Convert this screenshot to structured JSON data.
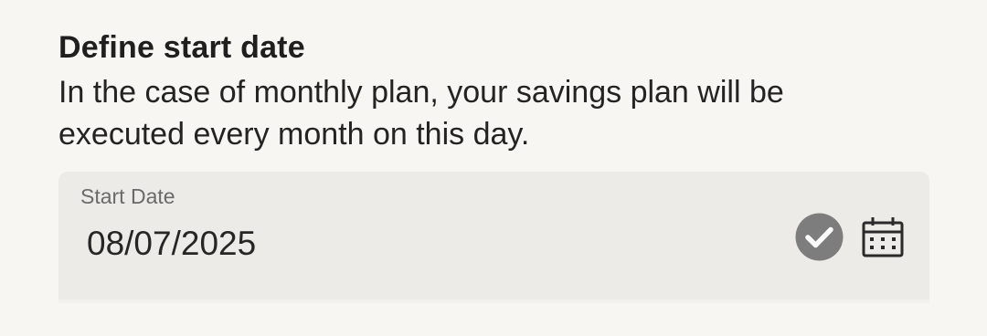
{
  "section": {
    "title": "Define start date",
    "description": "In the case of monthly plan, your savings plan will be executed every month on this day."
  },
  "start_date_field": {
    "label": "Start Date",
    "value": "08/07/2025",
    "valid_icon": "check-circle-icon",
    "picker_icon": "calendar-icon"
  },
  "colors": {
    "background": "#f7f6f2",
    "field_background": "#ecebe8",
    "check_icon": "#7d7d7d",
    "text": "#1f1f1f"
  }
}
